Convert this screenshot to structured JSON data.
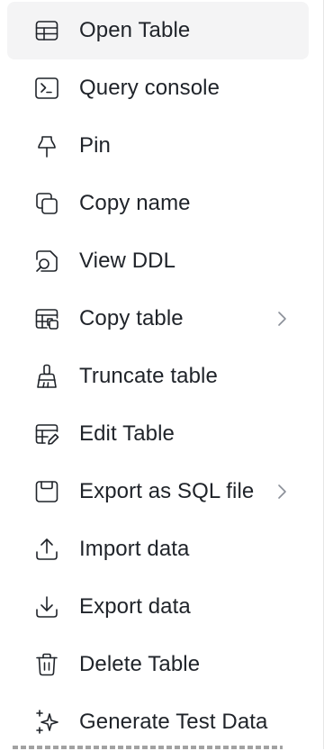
{
  "menu": {
    "items": [
      {
        "label": "Open Table",
        "icon": "table-icon",
        "active": true
      },
      {
        "label": "Query console",
        "icon": "terminal-icon"
      },
      {
        "label": "Pin",
        "icon": "pin-icon"
      },
      {
        "label": "Copy name",
        "icon": "copy-icon"
      },
      {
        "label": "View DDL",
        "icon": "view-ddl-icon"
      },
      {
        "label": "Copy table",
        "icon": "copy-table-icon",
        "submenu": true
      },
      {
        "label": "Truncate table",
        "icon": "broom-icon"
      },
      {
        "label": "Edit Table",
        "icon": "edit-table-icon"
      },
      {
        "label": "Export as SQL file",
        "icon": "save-icon",
        "submenu": true
      },
      {
        "label": "Import data",
        "icon": "upload-icon"
      },
      {
        "label": "Export data",
        "icon": "download-icon"
      },
      {
        "label": "Delete Table",
        "icon": "trash-icon"
      },
      {
        "label": "Generate Test Data",
        "icon": "sparkle-icon"
      }
    ]
  },
  "colors": {
    "text": "#1f2329",
    "active_bg": "#f4f4f5",
    "chevron": "#8a8f98"
  }
}
